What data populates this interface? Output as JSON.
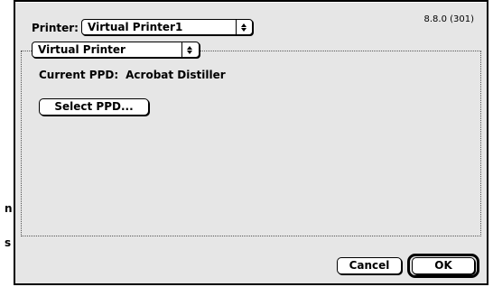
{
  "dialog": {
    "version": "8.8.0 (301)",
    "printer_label": "Printer:",
    "printer_selected": "Virtual Printer1",
    "section_selected": "Virtual Printer",
    "current_ppd_label": "Current PPD:",
    "current_ppd_value": "Acrobat Distiller",
    "select_ppd_label": "Select PPD...",
    "cancel_label": "Cancel",
    "ok_label": "OK"
  },
  "background_edge": {
    "chars": [
      "n",
      "s"
    ]
  },
  "colors": {
    "dialog_bg": "#e6e6e6",
    "button_bg": "#ffffff",
    "border": "#000000"
  }
}
